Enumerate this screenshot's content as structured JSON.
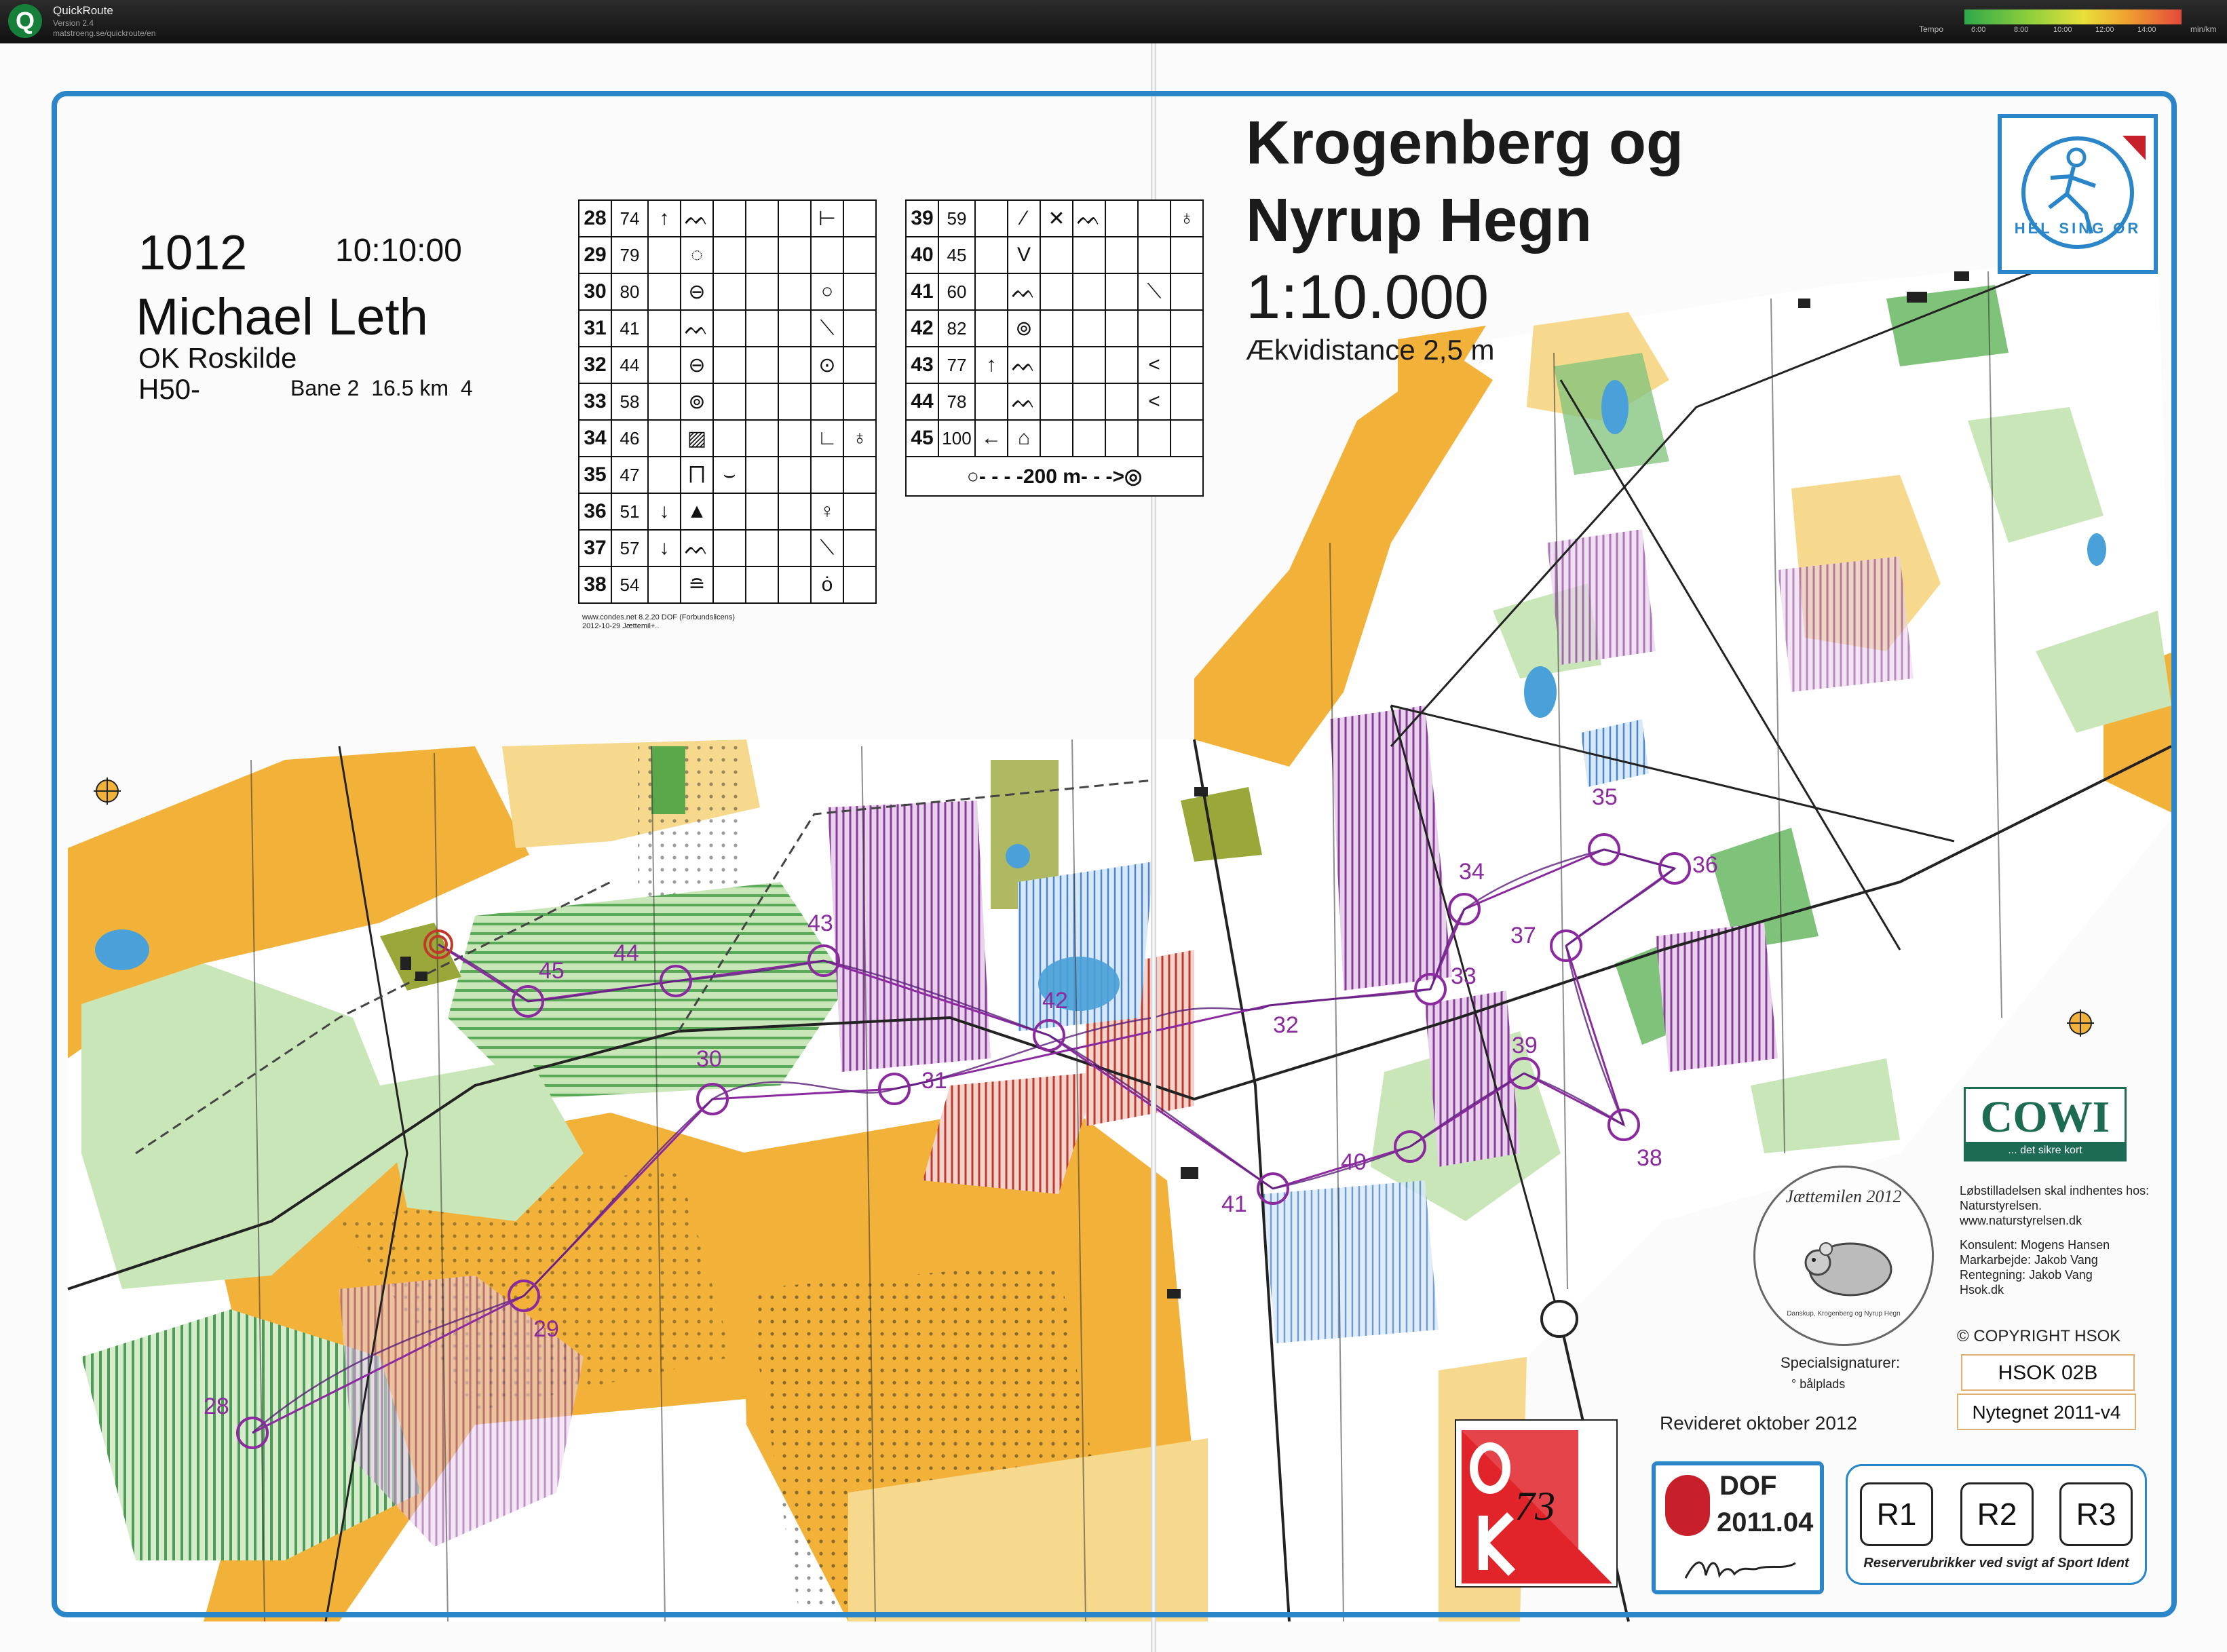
{
  "app": {
    "title": "QuickRoute",
    "version": "Version 2.4",
    "url": "matstroeng.se/quickroute/en",
    "tempo_label": "Tempo",
    "tempo_ticks": [
      "6:00",
      "8:00",
      "10:00",
      "12:00",
      "14:00"
    ],
    "tempo_unit": "min/km"
  },
  "runner": {
    "bib": "1012",
    "start_time": "10:10:00",
    "name": "Michael Leth",
    "club": "OK Roskilde",
    "class": "H50-",
    "course_info": "Bane 2  16.5 km  4"
  },
  "map": {
    "title_line1": "Krogenberg og",
    "title_line2": "Nyrup Hegn",
    "scale": "1:10.000",
    "contour_interval": "Ækvidistance 2,5 m",
    "club_logo_text": "HEL SING ØR",
    "revised": "Revideret oktober 2012",
    "map_code": "HSOK 02B",
    "map_version": "Nytegnet 2011-v4",
    "copyright": "© COPYRIGHT HSOK",
    "special_title": "Specialsignaturer:",
    "special_item": "° bålplads",
    "cowi_logo": "COWI",
    "cowi_tagline": "... det sikre kort",
    "info_lines": [
      "Løbstilladelsen skal indhentes hos:",
      "Naturstyrelsen.",
      "www.naturstyrelsen.dk",
      "",
      "Konsulent: Mogens Hansen",
      "Markarbejde: Jakob Vang",
      "Rentegning: Jakob Vang",
      "Hsok.dk"
    ],
    "medal_title": "Jættemilen 2012",
    "medal_sub": "Danskup, Krogenberg og Nyrup Hegn",
    "ok_number": "73",
    "dof_name": "DOF",
    "dof_number": "2011.04",
    "dof_signature": "Mogens",
    "reserve_boxes": [
      "R1",
      "R2",
      "R3"
    ],
    "reserve_caption": "Reserverubrikker ved svigt af Sport Ident"
  },
  "control_descriptions": {
    "left": [
      {
        "num": "28",
        "code": "74",
        "symbols": [
          "↑",
          "ᨓ",
          "",
          "",
          "",
          "⊢",
          ""
        ]
      },
      {
        "num": "29",
        "code": "79",
        "symbols": [
          "",
          "◌",
          "",
          "",
          "",
          "",
          ""
        ]
      },
      {
        "num": "30",
        "code": "80",
        "symbols": [
          "",
          "⊖",
          "",
          "",
          "",
          "○",
          ""
        ]
      },
      {
        "num": "31",
        "code": "41",
        "symbols": [
          "",
          "ᨓ",
          "",
          "",
          "",
          "⟍",
          ""
        ]
      },
      {
        "num": "32",
        "code": "44",
        "symbols": [
          "",
          "⊖",
          "",
          "",
          "",
          "⊙",
          ""
        ]
      },
      {
        "num": "33",
        "code": "58",
        "symbols": [
          "",
          "⊚",
          "",
          "",
          "",
          "",
          ""
        ]
      },
      {
        "num": "34",
        "code": "46",
        "symbols": [
          "",
          "▨",
          "",
          "",
          "",
          "∟",
          "♁"
        ]
      },
      {
        "num": "35",
        "code": "47",
        "symbols": [
          "",
          "⨅",
          "⌣",
          "",
          "",
          "",
          ""
        ]
      },
      {
        "num": "36",
        "code": "51",
        "symbols": [
          "↓",
          "▲",
          "",
          "",
          "",
          "♀",
          ""
        ]
      },
      {
        "num": "37",
        "code": "57",
        "symbols": [
          "↓",
          "ᨓ",
          "",
          "",
          "",
          "⟍",
          ""
        ]
      },
      {
        "num": "38",
        "code": "54",
        "symbols": [
          "",
          "≘",
          "",
          "",
          "",
          "ȯ",
          ""
        ]
      }
    ],
    "right": [
      {
        "num": "39",
        "code": "59",
        "symbols": [
          "",
          "⁄",
          "✕",
          "ᨓ",
          "",
          "",
          "♁"
        ]
      },
      {
        "num": "40",
        "code": "45",
        "symbols": [
          "",
          "V",
          "",
          "",
          "",
          "",
          ""
        ]
      },
      {
        "num": "41",
        "code": "60",
        "symbols": [
          "",
          "ᨓ",
          "",
          "",
          "",
          "⟍",
          ""
        ]
      },
      {
        "num": "42",
        "code": "82",
        "symbols": [
          "",
          "⊚",
          "",
          "",
          "",
          "",
          ""
        ]
      },
      {
        "num": "43",
        "code": "77",
        "symbols": [
          "↑",
          "ᨓ",
          "",
          "",
          "",
          "<",
          ""
        ]
      },
      {
        "num": "44",
        "code": "78",
        "symbols": [
          "",
          "ᨓ",
          "",
          "",
          "",
          "<",
          ""
        ]
      },
      {
        "num": "45",
        "code": "100",
        "symbols": [
          "←",
          "⌂",
          "",
          "",
          "",
          "",
          ""
        ]
      }
    ],
    "finish_row": "○- - - -200 m- - ->◎",
    "footer_lines": [
      "www.condes.net 8.2.20 DOF (Forbundslicens)",
      "2012-10-29 Jættemil+.."
    ]
  },
  "controls": [
    {
      "label": "28"
    },
    {
      "label": "29"
    },
    {
      "label": "30"
    },
    {
      "label": "31"
    },
    {
      "label": "32"
    },
    {
      "label": "33"
    },
    {
      "label": "34"
    },
    {
      "label": "35"
    },
    {
      "label": "36"
    },
    {
      "label": "37"
    },
    {
      "label": "38"
    },
    {
      "label": "39"
    },
    {
      "label": "40"
    },
    {
      "label": "41"
    },
    {
      "label": "42"
    },
    {
      "label": "43"
    },
    {
      "label": "44"
    },
    {
      "label": "45"
    }
  ],
  "colors": {
    "open_land": "#f2b23a",
    "rough_open": "#f7d98e",
    "forest_green": "#7fc27a",
    "light_green": "#c9e6b8",
    "course_purple": "#8a2a9e",
    "water_blue": "#4aa0d8",
    "frame_blue": "#2a86c8",
    "olive": "#9aa83a"
  }
}
